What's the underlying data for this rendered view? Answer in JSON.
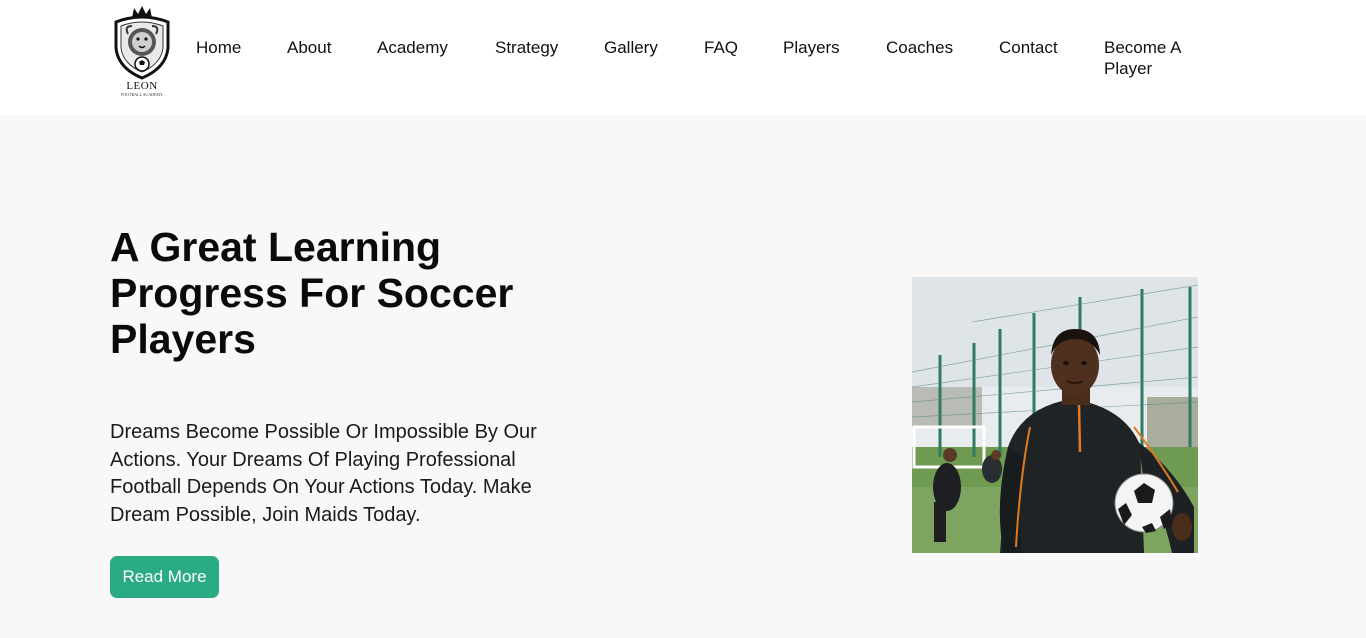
{
  "header": {
    "logo": {
      "name": "LEON",
      "subtitle": "FOOTBALL ACADEMY",
      "icon": "lion-shield-crest-icon"
    },
    "nav": [
      {
        "label": "Home"
      },
      {
        "label": "About"
      },
      {
        "label": "Academy"
      },
      {
        "label": "Strategy"
      },
      {
        "label": "Gallery"
      },
      {
        "label": "FAQ"
      },
      {
        "label": "Players"
      },
      {
        "label": "Coaches"
      },
      {
        "label": "Contact"
      },
      {
        "label": "Become A Player"
      }
    ]
  },
  "hero": {
    "title": "A Great Learning Progress For Soccer Players",
    "text": "Dreams Become Possible Or Impossible By Our Actions. Your Dreams Of Playing Professional Football Depends On Your Actions Today. Make Dream Possible, Join Maids Today.",
    "button_label": "Read More",
    "image": "soccer-player-holding-ball-photo"
  },
  "colors": {
    "accent": "#2aab83",
    "header_bg": "#ffffff",
    "page_bg": "#f8f8f8",
    "text": "#111111"
  }
}
